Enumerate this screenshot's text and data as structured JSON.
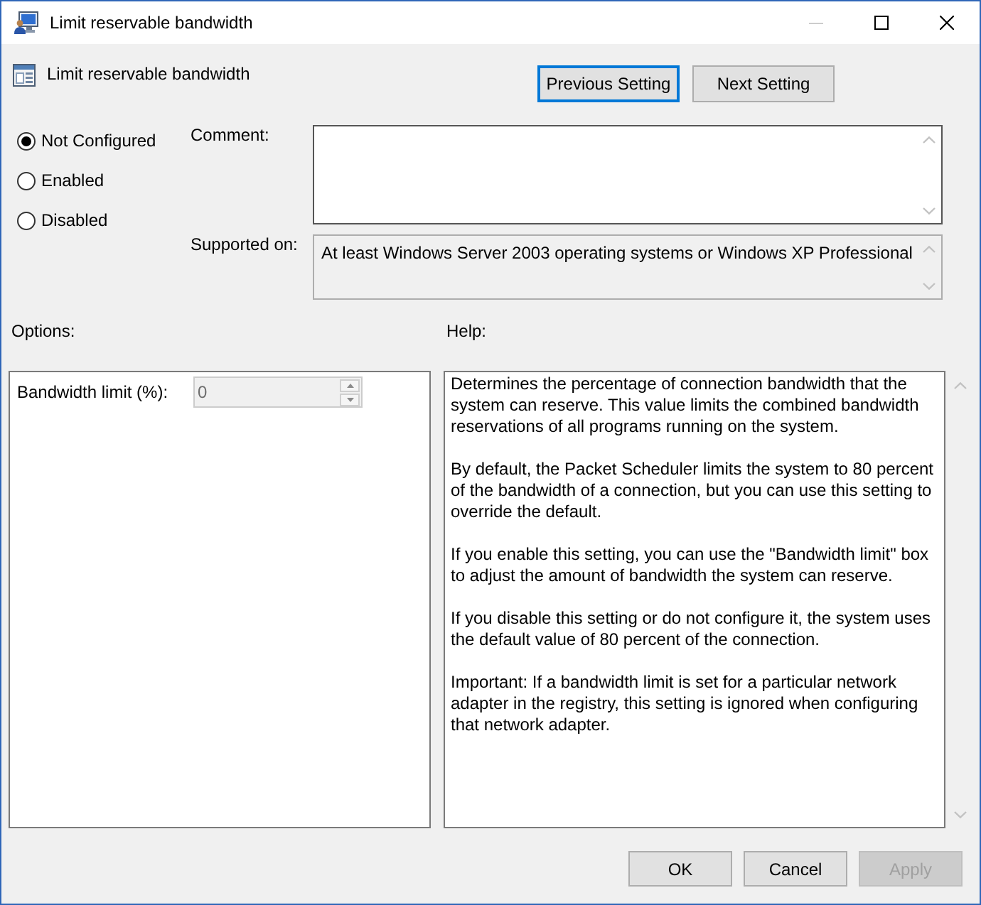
{
  "window": {
    "title": "Limit reservable bandwidth",
    "controls": [
      {
        "kind": "minimize",
        "disabled": true
      },
      {
        "kind": "maximize",
        "disabled": false
      },
      {
        "kind": "close",
        "disabled": false
      }
    ]
  },
  "header": {
    "title": "Limit reservable bandwidth",
    "buttons": [
      {
        "label": "Previous Setting",
        "focused": true
      },
      {
        "label": "Next Setting",
        "focused": false
      }
    ]
  },
  "state_options": [
    {
      "label": "Not Configured",
      "selected": true
    },
    {
      "label": "Enabled",
      "selected": false
    },
    {
      "label": "Disabled",
      "selected": false
    }
  ],
  "comment": {
    "label": "Comment:"
  },
  "supported_on": {
    "label": "Supported on:",
    "value": "At least Windows Server 2003 operating systems or Windows XP Professional"
  },
  "options": {
    "label": "Options:",
    "fields": [
      {
        "kind": "spinner",
        "label": "Bandwidth limit (%):",
        "value": "0",
        "disabled": true
      }
    ]
  },
  "help": {
    "label": "Help:",
    "paragraphs": [
      "Determines the percentage of connection bandwidth that the system can reserve. This value limits the combined bandwidth reservations of all programs running on the system.",
      "By default, the Packet Scheduler limits the system to 80 percent of the bandwidth of a connection, but you can use this setting to override the default.",
      "If you enable this setting, you can use the \"Bandwidth limit\" box to adjust the amount of bandwidth the system can reserve.",
      "If you disable this setting or do not configure it, the system uses the default value of 80 percent of the connection.",
      "Important: If a bandwidth limit is set for a particular network adapter in the registry, this setting is ignored when configuring that network adapter."
    ]
  },
  "buttons": [
    {
      "label": "OK",
      "disabled": false
    },
    {
      "label": "Cancel",
      "disabled": false
    },
    {
      "label": "Apply",
      "disabled": true
    }
  ]
}
